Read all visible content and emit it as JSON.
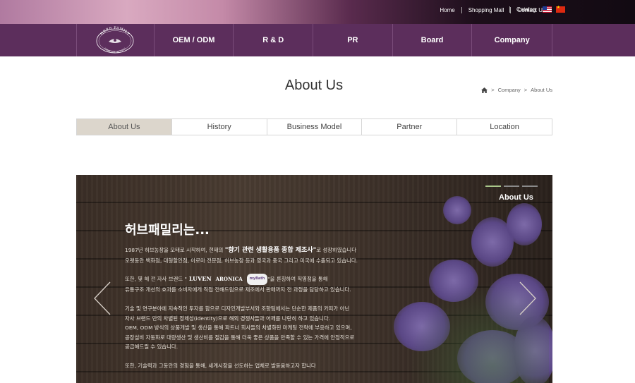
{
  "top_links": [
    {
      "label": "Home"
    },
    {
      "label": "Shopping Mall"
    },
    {
      "label": "Contact Us"
    }
  ],
  "catalog_label": "Catalog",
  "logo": {
    "top_text": "HERB FAMILY",
    "bottom_text": "HERB COLLECTION"
  },
  "nav": [
    {
      "label": "OEM / ODM"
    },
    {
      "label": "R & D"
    },
    {
      "label": "PR"
    },
    {
      "label": "Board"
    },
    {
      "label": "Company"
    }
  ],
  "page_title": "About Us",
  "breadcrumb": {
    "sep": ">",
    "items": [
      "Company",
      "About Us"
    ]
  },
  "subtabs": [
    {
      "label": "About Us",
      "active": true
    },
    {
      "label": "History",
      "active": false
    },
    {
      "label": "Business Model",
      "active": false
    },
    {
      "label": "Partner",
      "active": false
    },
    {
      "label": "Location",
      "active": false
    }
  ],
  "hero": {
    "label": "About Us",
    "heading": "허브패밀리는...",
    "p1_pre": "1987년 허브농장을 모태로 시작하여, 현재의 ",
    "p1_highlight": "\"향기 관련 생활용품 종합 제조사\"",
    "p1_post": "로 성장하였습니다",
    "p1_line2": "오랫동안 백화점, 대형할인점, 아로마 전문점, 허브농장 등과 영국과 중국 그리고 미국에 수출되고 있습니다.",
    "p2_pre": "또한, 몇 해 전 자사 브랜드 \"",
    "brand1": "LUVEN",
    "brand2": "ARONICA",
    "brand3": "myBath",
    "p2_post": "\"을 론칭하여 직영점을 통해",
    "p2_line2": "유통구조 개선의 효과를 소비자에게 직접 전해드림으로 제조에서 판매까지 전 과정을 담당하고 있습니다.",
    "p3_lines": [
      "기술 및 연구분야에 지속적인 투자를 함으로 디자인개발부서와 조향팀에서는 단순한 제품의 카피가 아닌",
      "자사 브랜드 만의 차별된 정체성(identity)으로 해외 경쟁사들과 어깨를 나란히 하고 있습니다.",
      "OEM, ODM 방식의 상품개발 및 생산을 통해 파트너 회사들의 차별화된 마케팅 전략에 부응하고 있으며,",
      "공장설비 자동화로 대량생산 및 생산비를 절감을 통해 더욱 좋은 상품을 만족할 수 있는 가격에 안정적으로",
      "공급해드릴 수 있습니다."
    ],
    "p4": "또한, 기술력과 그동안의 경험을 통해, 세계시장을 선도하는 업체로 발돋움하고자 합니다",
    "slides_total": 3,
    "slide_current": 1
  },
  "colors": {
    "nav_bg": "#5c2e5c",
    "tab_active_bg": "#dcd6cc",
    "highlight": "#a9c78a"
  }
}
